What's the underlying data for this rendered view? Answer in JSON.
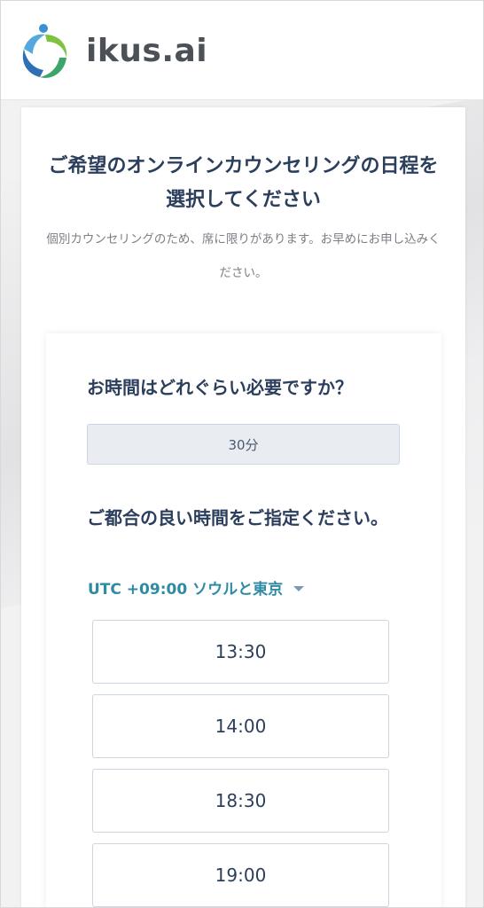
{
  "header": {
    "logo_text": "ikus.ai"
  },
  "main": {
    "title": "ご希望のオンラインカウンセリングの日程を選択してください",
    "subtitle": "個別カウンセリングのため、席に限りがあります。お早めにお申し込みください。",
    "duration_question": "お時間はどれぐらい必要ですか？",
    "duration_selected": "30分",
    "time_question": "ご都合の良い時間をご指定ください。",
    "timezone": "UTC +09:00 ソウルと東京",
    "time_slots": [
      "13:30",
      "14:00",
      "18:30",
      "19:00"
    ]
  },
  "colors": {
    "heading": "#2b3e5c",
    "accent": "#2f8aa4",
    "subtext": "#7b7f85",
    "slot_border": "#cbd6e2"
  }
}
